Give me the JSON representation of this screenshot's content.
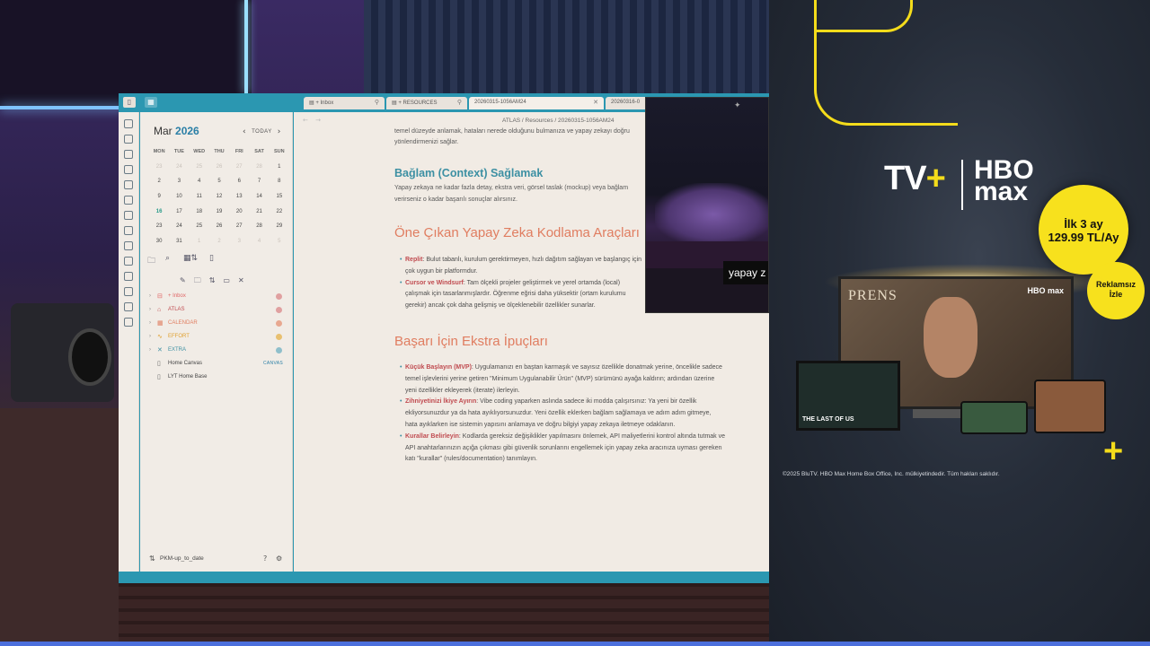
{
  "app": {
    "tabs": [
      {
        "label": "+ Inbox",
        "pinned": true
      },
      {
        "label": "+ RESOURCES",
        "pinned": true
      },
      {
        "label": "20260315-1056AM24",
        "active": true
      },
      {
        "label": "20260316-0"
      }
    ],
    "breadcrumb": "ATLAS / Resources / 20260315-1056AM24"
  },
  "calendar": {
    "month": "Mar",
    "year": "2026",
    "today_label": "TODAY",
    "dow": [
      "MON",
      "TUE",
      "WED",
      "THU",
      "FRI",
      "SAT",
      "SUN"
    ],
    "weeks": [
      [
        "23",
        "24",
        "25",
        "26",
        "27",
        "28",
        "1"
      ],
      [
        "2",
        "3",
        "4",
        "5",
        "6",
        "7",
        "8"
      ],
      [
        "9",
        "10",
        "11",
        "12",
        "13",
        "14",
        "15"
      ],
      [
        "16",
        "17",
        "18",
        "19",
        "20",
        "21",
        "22"
      ],
      [
        "23",
        "24",
        "25",
        "26",
        "27",
        "28",
        "29"
      ],
      [
        "30",
        "31",
        "1",
        "2",
        "3",
        "4",
        "5"
      ]
    ]
  },
  "tree": [
    {
      "label": "+ Inbox",
      "color": "#e06666",
      "dot": "#e0a0a0"
    },
    {
      "label": "ATLAS",
      "color": "#c04b50",
      "dot": "#e0a0a0"
    },
    {
      "label": "CALENDAR",
      "color": "#e07d60",
      "dot": "#e8a890"
    },
    {
      "label": "EFFORT",
      "color": "#e0a030",
      "dot": "#e8c070"
    },
    {
      "label": "EXTRA",
      "color": "#3d90a3",
      "dot": "#8fbfcb"
    }
  ],
  "files": [
    {
      "label": "Home Canvas",
      "badge": "CANVAS"
    },
    {
      "label": "LYT Home Base"
    }
  ],
  "vault_name": "PKM-up_to_date",
  "document": {
    "intro": "temel düzeyde anlamak, hataları nerede olduğunu bulmanıza ve yapay zekayı doğru yönlendirmenizi sağlar.",
    "h2": "Bağlam (Context) Sağlamak",
    "p2": "Yapay zekaya ne kadar fazla detay, ekstra veri, görsel taslak (mockup) veya bağlam verirseniz o kadar başarılı sonuçlar alırsınız.",
    "h3a": "Öne Çıkan Yapay Zeka Kodlama Araçları",
    "tools": [
      {
        "term": "Replit",
        "text": ": Bulut tabanlı, kurulum gerektirmeyen, hızlı dağıtım sağlayan ve başlangıç için çok uygun bir platformdur."
      },
      {
        "term": "Cursor ve Windsurf",
        "text": ": Tam ölçekli projeler geliştirmek ve yerel ortamda (local) çalışmak için tasarlanmışlardır. Öğrenme eğrisi daha yüksektir (ortam kurulumu gerekir) ancak çok daha gelişmiş ve ölçeklenebilir özellikler sunarlar."
      }
    ],
    "h3b": "Başarı İçin Ekstra İpuçları",
    "tips": [
      {
        "term": "Küçük Başlayın (MVP)",
        "text": ": Uygulamanızı en baştan karmaşık ve sayısız özellikle donatmak yerine, öncelikle sadece temel işlevlerini yerine getiren \"Minimum Uygulanabilir Ürün\" (MVP) sürümünü ayağa kaldırın; ardından üzerine yeni özellikler ekleyerek (iterate) ilerleyin."
      },
      {
        "term": "Zihniyetinizi İkiye Ayırın",
        "text": ": Vibe coding yaparken aslında sadece iki modda çalışırsınız: Ya yeni bir özellik ekliyorsunuzdur ya da hata ayıklıyorsunuzdur. Yeni özellik eklerken bağlam sağlamaya ve adım adım gitmeye, hata ayıklarken ise sistemin yapısını anlamaya ve doğru bilgiyi yapay zekaya iletmeye odaklanın."
      },
      {
        "term": "Kurallar Belirleyin",
        "text": ": Kodlarda gereksiz değişiklikler yapılmasını önlemek, API maliyetlerini kontrol altında tutmak ve API anahtarlarınızın açığa çıkması gibi güvenlik sorunlarını engellemek için yapay zeka aracınıza uyması gereken katı \"kurallar\" (rules/documentation) tanımlayın."
      }
    ]
  },
  "video_caption": "yapay z",
  "ad": {
    "tv_logo": "TV",
    "hbo_line1": "HBO",
    "hbo_line2": "max",
    "price_line1": "İlk 3 ay",
    "price_line2": "129.99 TL/Ay",
    "noads_line1": "Reklamsız",
    "noads_line2": "İzle",
    "show_title": "PRENS",
    "tv_brand": "HBO max",
    "laptop_title": "THE LAST OF US",
    "copyright": "©2025 BluTV. HBO Max Home Box Office, Inc. mülkiyetindedir. Tüm hakları saklıdır.",
    "accent": "#f4dc1b"
  }
}
